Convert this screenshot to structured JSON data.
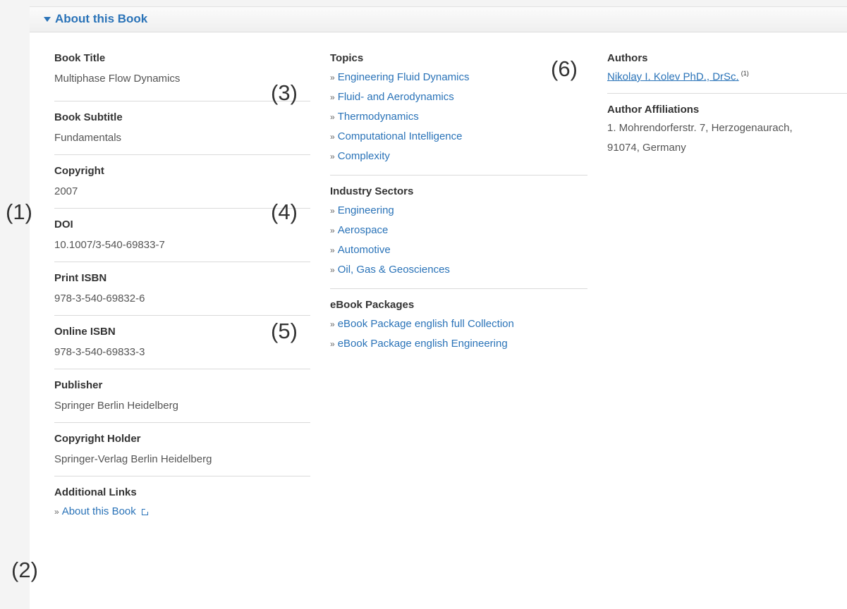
{
  "section": {
    "title": "About this Book"
  },
  "details": [
    {
      "label": "Book Title",
      "value": "Multiphase Flow Dynamics"
    },
    {
      "label": "Book Subtitle",
      "value": "Fundamentals"
    },
    {
      "label": "Copyright",
      "value": "2007"
    },
    {
      "label": "DOI",
      "value": "10.1007/3-540-69833-7"
    },
    {
      "label": "Print ISBN",
      "value": "978-3-540-69832-6"
    },
    {
      "label": "Online ISBN",
      "value": "978-3-540-69833-3"
    },
    {
      "label": "Publisher",
      "value": "Springer Berlin Heidelberg"
    },
    {
      "label": "Copyright Holder",
      "value": "Springer-Verlag Berlin Heidelberg"
    }
  ],
  "additional_links": {
    "label": "Additional Links",
    "prefix": "»",
    "items": [
      "About this Book"
    ]
  },
  "topics": {
    "label": "Topics",
    "prefix": "»",
    "items": [
      "Engineering Fluid Dynamics",
      "Fluid- and Aerodynamics",
      "Thermodynamics",
      "Computational Intelligence",
      "Complexity"
    ]
  },
  "industry": {
    "label": "Industry Sectors",
    "prefix": "»",
    "items": [
      "Engineering",
      "Aerospace",
      "Automotive",
      "Oil, Gas & Geosciences"
    ]
  },
  "packages": {
    "label": "eBook Packages",
    "prefix": "»",
    "items": [
      "eBook Package english full Collection",
      "eBook Package english Engineering"
    ]
  },
  "authors": {
    "label": "Authors",
    "name": "Nikolay I. Kolev PhD., DrSc.",
    "sup": "(1)"
  },
  "affiliations": {
    "label": "Author Affiliations",
    "line1": "1. Mohrendorferstr. 7, Herzogenaurach,",
    "line2": "91074, Germany"
  },
  "annotations": [
    "(1)",
    "(2)",
    "(3)",
    "(4)",
    "(5)",
    "(6)"
  ],
  "colors": {
    "link": "#2a73b8",
    "text": "#333333",
    "muted": "#555555"
  }
}
